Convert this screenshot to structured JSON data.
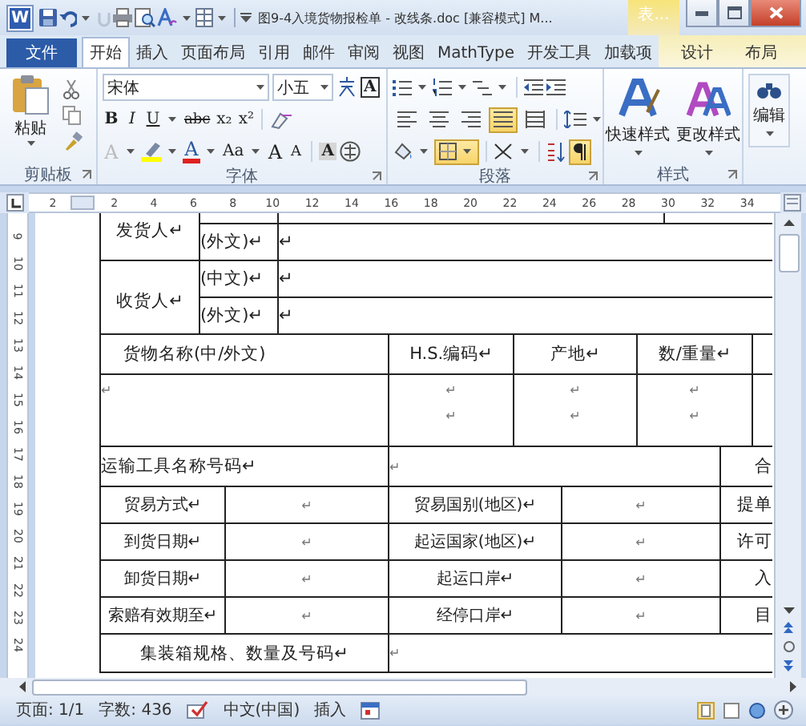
{
  "window": {
    "app_letter": "W",
    "title": "图9-4入境货物报检单 - 改线条.doc [兼容模式] M...",
    "context_title": "表..."
  },
  "tabs": [
    {
      "label": "文件",
      "kind": "file",
      "selected": false
    },
    {
      "label": "开始",
      "kind": "main",
      "selected": true
    },
    {
      "label": "插入",
      "kind": "main",
      "selected": false
    },
    {
      "label": "页面布局",
      "kind": "main",
      "selected": false
    },
    {
      "label": "引用",
      "kind": "main",
      "selected": false
    },
    {
      "label": "邮件",
      "kind": "main",
      "selected": false
    },
    {
      "label": "审阅",
      "kind": "main",
      "selected": false
    },
    {
      "label": "视图",
      "kind": "main",
      "selected": false
    },
    {
      "label": "MathType",
      "kind": "main",
      "selected": false
    },
    {
      "label": "开发工具",
      "kind": "main",
      "selected": false
    },
    {
      "label": "加载项",
      "kind": "main",
      "selected": false
    },
    {
      "label": "设计",
      "kind": "context",
      "selected": false
    },
    {
      "label": "布局",
      "kind": "context",
      "selected": false
    }
  ],
  "ribbon": {
    "clipboard": {
      "paste": "粘贴",
      "label": "剪贴板"
    },
    "font": {
      "name": "宋体",
      "size": "小五",
      "border_char": "A",
      "label": "字体",
      "format": [
        {
          "text": "B",
          "kind": "bold"
        },
        {
          "text": "I",
          "kind": "italic"
        },
        {
          "text": "U",
          "kind": "underline"
        },
        {
          "text": "abc",
          "kind": "strike"
        },
        {
          "text": "x₂",
          "kind": "sub"
        },
        {
          "text": "x²",
          "kind": "sup"
        }
      ],
      "effects": [
        {
          "text": "A",
          "kind": "effects"
        },
        {
          "text": "A",
          "kind": "color"
        },
        {
          "text": "Aa",
          "kind": "case"
        },
        {
          "text": "A",
          "kind": "grow"
        },
        {
          "text": "A",
          "kind": "shrink"
        },
        {
          "text": "A",
          "kind": "shade"
        }
      ]
    },
    "paragraph": {
      "label": "段落",
      "borders_on": true,
      "show_marks_on": true,
      "alignment": [
        {
          "kind": "left",
          "selected": false
        },
        {
          "kind": "center",
          "selected": false
        },
        {
          "kind": "right",
          "selected": false
        },
        {
          "kind": "justify",
          "selected": true
        },
        {
          "kind": "distributed",
          "selected": false
        }
      ]
    },
    "styles": {
      "quick": "快速样式",
      "change": "更改样式",
      "label": "样式"
    },
    "editing": {
      "label": "编辑"
    }
  },
  "ruler": {
    "h_marks": [
      "2",
      "2",
      "4",
      "6",
      "8",
      "10",
      "12",
      "14",
      "16",
      "18",
      "20",
      "22",
      "24",
      "26",
      "28",
      "30",
      "32",
      "34"
    ],
    "v_marks": [
      "9",
      "10",
      "11",
      "12",
      "13",
      "14",
      "15",
      "16",
      "17",
      "18",
      "19",
      "20",
      "21",
      "22",
      "23",
      "24"
    ]
  },
  "table": {
    "rows": [
      {
        "kind": "party",
        "continued": true,
        "label": "发货人↵",
        "lines": [
          {
            "text": "(外文)↵",
            "value": "↵"
          }
        ]
      },
      {
        "kind": "party",
        "continued": false,
        "label": "收货人↵",
        "lines": [
          {
            "text": "(中文)↵",
            "value": "↵"
          },
          {
            "text": "(外文)↵",
            "value": "↵"
          }
        ]
      },
      {
        "kind": "goods_header",
        "cells": [
          "货物名称(中/外文)",
          "H.S.编码↵",
          "产地↵",
          "数/重量↵",
          ""
        ]
      },
      {
        "kind": "goods_blank",
        "cells": [
          "↵",
          "↵\n↵",
          "↵\n↵",
          "↵\n↵",
          ""
        ]
      },
      {
        "kind": "transport",
        "cells": [
          "运输工具名称号码↵",
          "↵",
          "合"
        ]
      },
      {
        "kind": "trade",
        "cells": [
          "贸易方式↵",
          "↵",
          "贸易国别(地区)↵",
          "↵",
          "提单"
        ]
      },
      {
        "kind": "trade",
        "cells": [
          "到货日期↵",
          "↵",
          "起运国家(地区)↵",
          "↵",
          "许可"
        ]
      },
      {
        "kind": "trade",
        "cells": [
          "卸货日期↵",
          "↵",
          "起运口岸↵",
          "↵",
          "入"
        ]
      },
      {
        "kind": "trade",
        "cells": [
          "索赔有效期至↵",
          "↵",
          "经停口岸↵",
          "↵",
          "目"
        ]
      },
      {
        "kind": "container",
        "cells": [
          "集装箱规格、数量及号码↵",
          "↵"
        ]
      }
    ]
  },
  "status_bar": {
    "page": "页面: 1/1",
    "words": "字数: 436",
    "language": "中文(中国)",
    "mode": "插入"
  }
}
